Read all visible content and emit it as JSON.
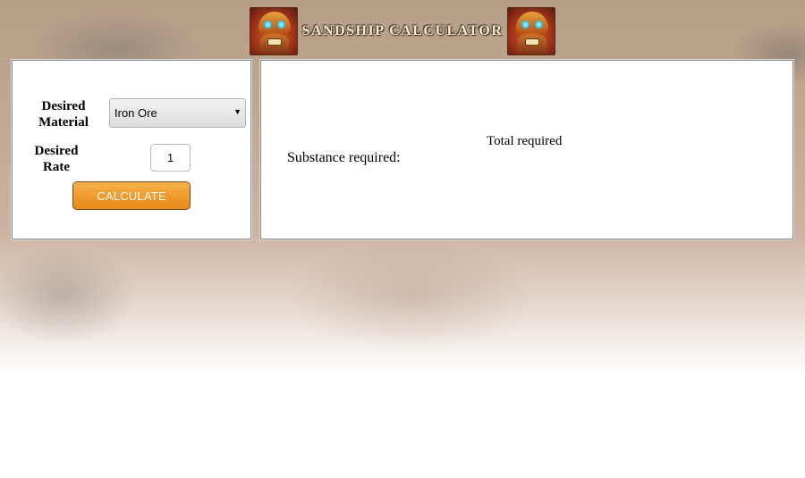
{
  "header": {
    "title": "SANDSHIP CALCULATOR",
    "left_icon": "robot-mascot-icon",
    "right_icon": "robot-mascot-icon"
  },
  "form": {
    "material_label": "Desired Material",
    "material_selected": "Iron Ore",
    "rate_label": "Desired Rate",
    "rate_value": "1",
    "calculate_button": "CALCULATE"
  },
  "results": {
    "substance_label": "Substance required:",
    "total_label": "Total required"
  },
  "colors": {
    "button": "#ef9a2a",
    "title_text": "#f6ecd0"
  }
}
